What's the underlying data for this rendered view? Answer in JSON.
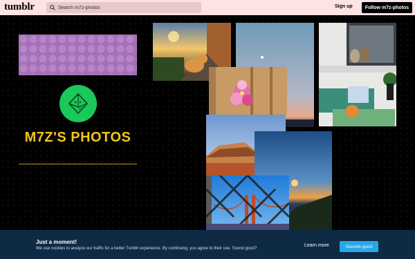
{
  "topbar": {
    "logo": "tumblr",
    "search_placeholder": "Search m7z-photos",
    "sign_up": "Sign up",
    "follow": "Follow m7z-photos",
    "icons": [
      "search-icon"
    ]
  },
  "blog": {
    "title": "M7Z'S PHOTOS",
    "accent_color": "#f5c518",
    "avatar_color": "#1bc85a",
    "header_color": "#a670b8"
  },
  "photos": [
    {
      "subject": "cat on sunset street"
    },
    {
      "subject": "evening sky with moon"
    },
    {
      "subject": "cats on windowsill"
    },
    {
      "subject": "pink flower against wooden wall"
    },
    {
      "subject": "rooftop under blue sky"
    },
    {
      "subject": "sunset over ocean"
    },
    {
      "subject": "bridge through chain fence"
    }
  ],
  "cookie_banner": {
    "title": "Just a moment!",
    "text": "We use cookies to analyze our traffic for a better Tumblr experience. By continuing, you agree to their use. Sound good?",
    "learn_more": "Learn more",
    "accept": "Sounds good",
    "background": "#0f2a45",
    "accept_color": "#2aa8e6"
  }
}
